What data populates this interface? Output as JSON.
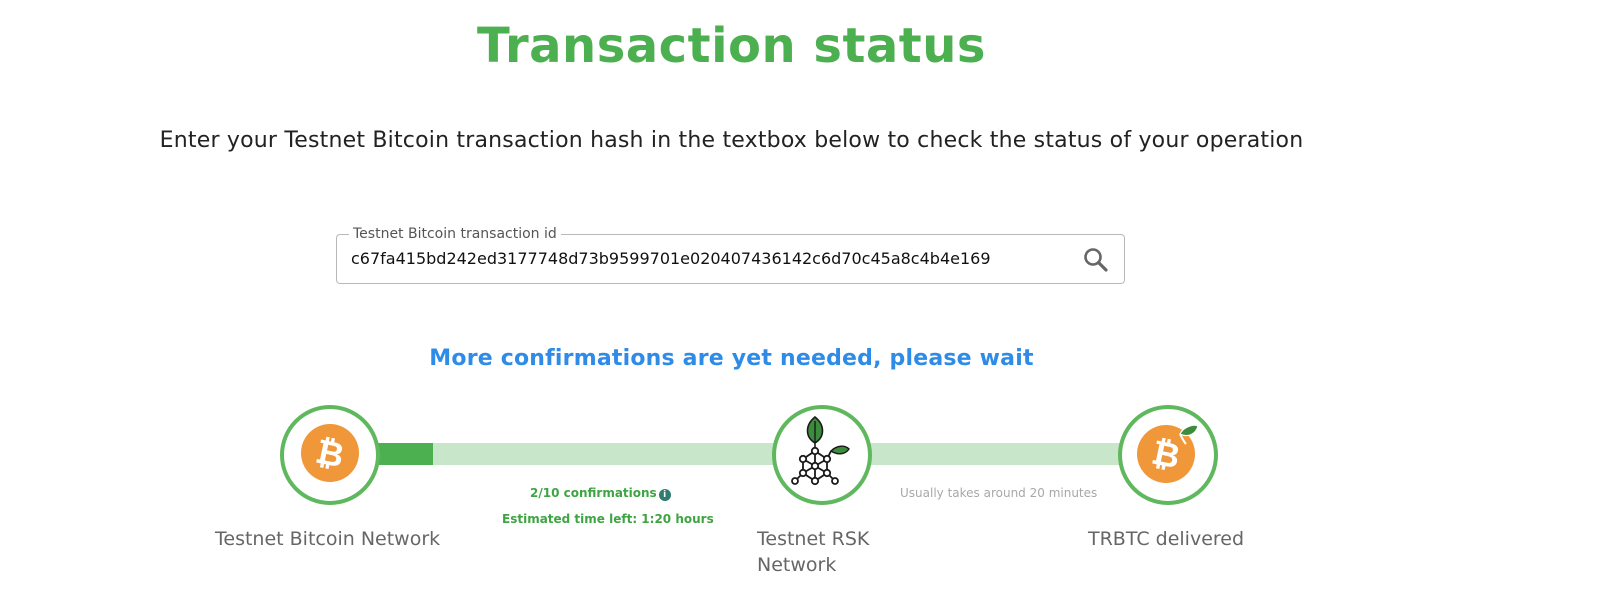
{
  "page": {
    "title": "Transaction status",
    "subtitle": "Enter your Testnet Bitcoin transaction hash in the textbox below to check the status of your operation"
  },
  "search": {
    "label": "Testnet Bitcoin transaction id",
    "value": "c67fa415bd242ed3177748d73b9599701e020407436142c6d70c45a8c4b4e169",
    "icon": "search-icon"
  },
  "status": {
    "message": "More confirmations are yet needed, please wait"
  },
  "steps": [
    {
      "label": "Testnet Bitcoin Network",
      "icon": "bitcoin-icon"
    },
    {
      "label": "Testnet RSK Network",
      "icon": "rsk-icon"
    },
    {
      "label": "TRBTC delivered",
      "icon": "rbtc-icon"
    }
  ],
  "progress": {
    "confirmations": "2/10 confirmations",
    "confirmations_done": 2,
    "confirmations_required": 10,
    "info_glyph": "i",
    "eta": "Estimated time left: 1:20 hours",
    "second_leg_hint": "Usually takes around 20 minutes"
  },
  "colors": {
    "title_green": "#4caf50",
    "status_blue": "#2e8ce8",
    "track_light": "#c8e6c9",
    "track_fill": "#4caf50",
    "bitcoin_orange": "#f0973a"
  }
}
